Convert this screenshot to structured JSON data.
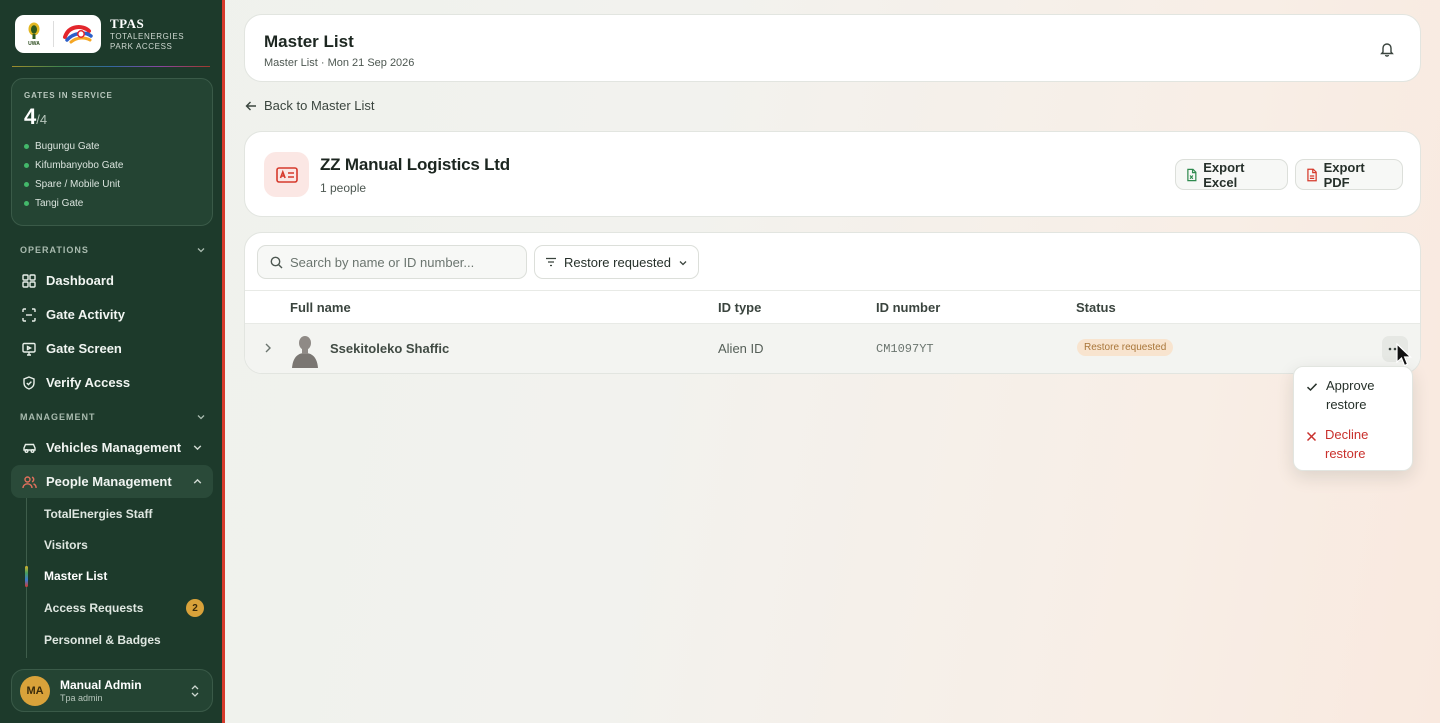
{
  "brand": {
    "title": "TPAS",
    "subtitle_line1": "TOTALENERGIES",
    "subtitle_line2": "PARK ACCESS",
    "logo_text": "UWA"
  },
  "gates": {
    "label": "GATES IN SERVICE",
    "count": "4",
    "total": "/4",
    "items": [
      "Bugungu Gate",
      "Kifumbanyobo Gate",
      "Spare / Mobile Unit",
      "Tangi Gate"
    ]
  },
  "sections": {
    "operations": "OPERATIONS",
    "management": "MANAGEMENT"
  },
  "nav": {
    "dashboard": "Dashboard",
    "gate_activity": "Gate Activity",
    "gate_screen": "Gate Screen",
    "verify_access": "Verify Access",
    "vehicles": "Vehicles Management",
    "people": "People Management"
  },
  "people_sub": {
    "staff": "TotalEnergies Staff",
    "visitors": "Visitors",
    "master_list": "Master List",
    "access_requests": "Access Requests",
    "access_requests_badge": "2",
    "personnel": "Personnel & Badges"
  },
  "user": {
    "initials": "MA",
    "name": "Manual Admin",
    "role": "Tpa admin"
  },
  "header": {
    "title": "Master List",
    "subtitle": "Master List · Mon 21 Sep 2026"
  },
  "back_link": "Back to Master List",
  "company": {
    "name": "ZZ Manual Logistics Ltd",
    "count": "1 people",
    "export_excel": "Export Excel",
    "export_pdf": "Export PDF"
  },
  "filters": {
    "search_placeholder": "Search by name or ID number...",
    "status_filter": "Restore requested"
  },
  "table": {
    "columns": [
      "Full name",
      "ID type",
      "ID number",
      "Status"
    ],
    "rows": [
      {
        "full_name": "Ssekitoleko Shaffic",
        "id_type": "Alien ID",
        "id_number": "CM1097YT",
        "status": "Restore requested"
      }
    ]
  },
  "row_menu": {
    "approve": "Approve restore",
    "decline": "Decline restore"
  },
  "colors": {
    "sidebar": "#1d3a2b",
    "accent_red": "#d63a2c",
    "badge": "#d9a23a",
    "status_bg": "#f8e4cf",
    "decline": "#c9302c"
  }
}
